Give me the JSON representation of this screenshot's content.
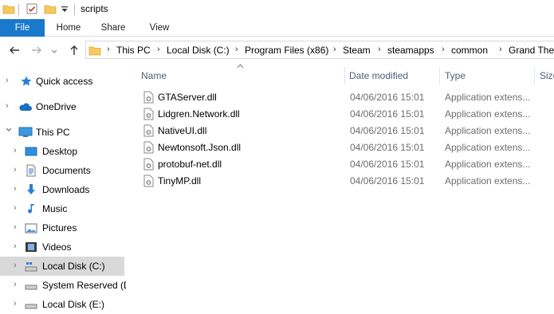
{
  "window": {
    "title": "scripts"
  },
  "ribbon": {
    "tabs": [
      "File",
      "Home",
      "Share",
      "View"
    ]
  },
  "address_bar": {
    "crumbs": [
      "This PC",
      "Local Disk (C:)",
      "Program Files (x86)",
      "Steam",
      "steamapps",
      "common",
      "Grand Theft"
    ]
  },
  "nav_pane": {
    "items": [
      {
        "label": "Quick access",
        "icon": "star-icon"
      },
      {
        "label": "OneDrive",
        "icon": "cloud-icon"
      },
      {
        "label": "This PC",
        "icon": "computer-icon"
      },
      {
        "label": "Desktop",
        "icon": "desktop-icon"
      },
      {
        "label": "Documents",
        "icon": "documents-icon"
      },
      {
        "label": "Downloads",
        "icon": "download-icon"
      },
      {
        "label": "Music",
        "icon": "music-icon"
      },
      {
        "label": "Pictures",
        "icon": "pictures-icon"
      },
      {
        "label": "Videos",
        "icon": "videos-icon"
      },
      {
        "label": "Local Disk (C:)",
        "icon": "drive-icon"
      },
      {
        "label": "System Reserved (D",
        "icon": "drive-icon"
      },
      {
        "label": "Local Disk (E:)",
        "icon": "drive-icon"
      }
    ]
  },
  "file_list": {
    "columns": {
      "name": "Name",
      "date": "Date modified",
      "type": "Type",
      "size": "Size"
    },
    "rows": [
      {
        "name": "GTAServer.dll",
        "date": "04/06/2016 15:01",
        "type": "Application extens..."
      },
      {
        "name": "Lidgren.Network.dll",
        "date": "04/06/2016 15:01",
        "type": "Application extens..."
      },
      {
        "name": "NativeUI.dll",
        "date": "04/06/2016 15:01",
        "type": "Application extens..."
      },
      {
        "name": "Newtonsoft.Json.dll",
        "date": "04/06/2016 15:01",
        "type": "Application extens..."
      },
      {
        "name": "protobuf-net.dll",
        "date": "04/06/2016 15:01",
        "type": "Application extens..."
      },
      {
        "name": "TinyMP.dll",
        "date": "04/06/2016 15:01",
        "type": "Application extens..."
      }
    ]
  },
  "colors": {
    "accent": "#1979ca",
    "selected": "#d9d9d9",
    "header_text": "#4c607a",
    "secondary_text": "#6d6d6d"
  }
}
